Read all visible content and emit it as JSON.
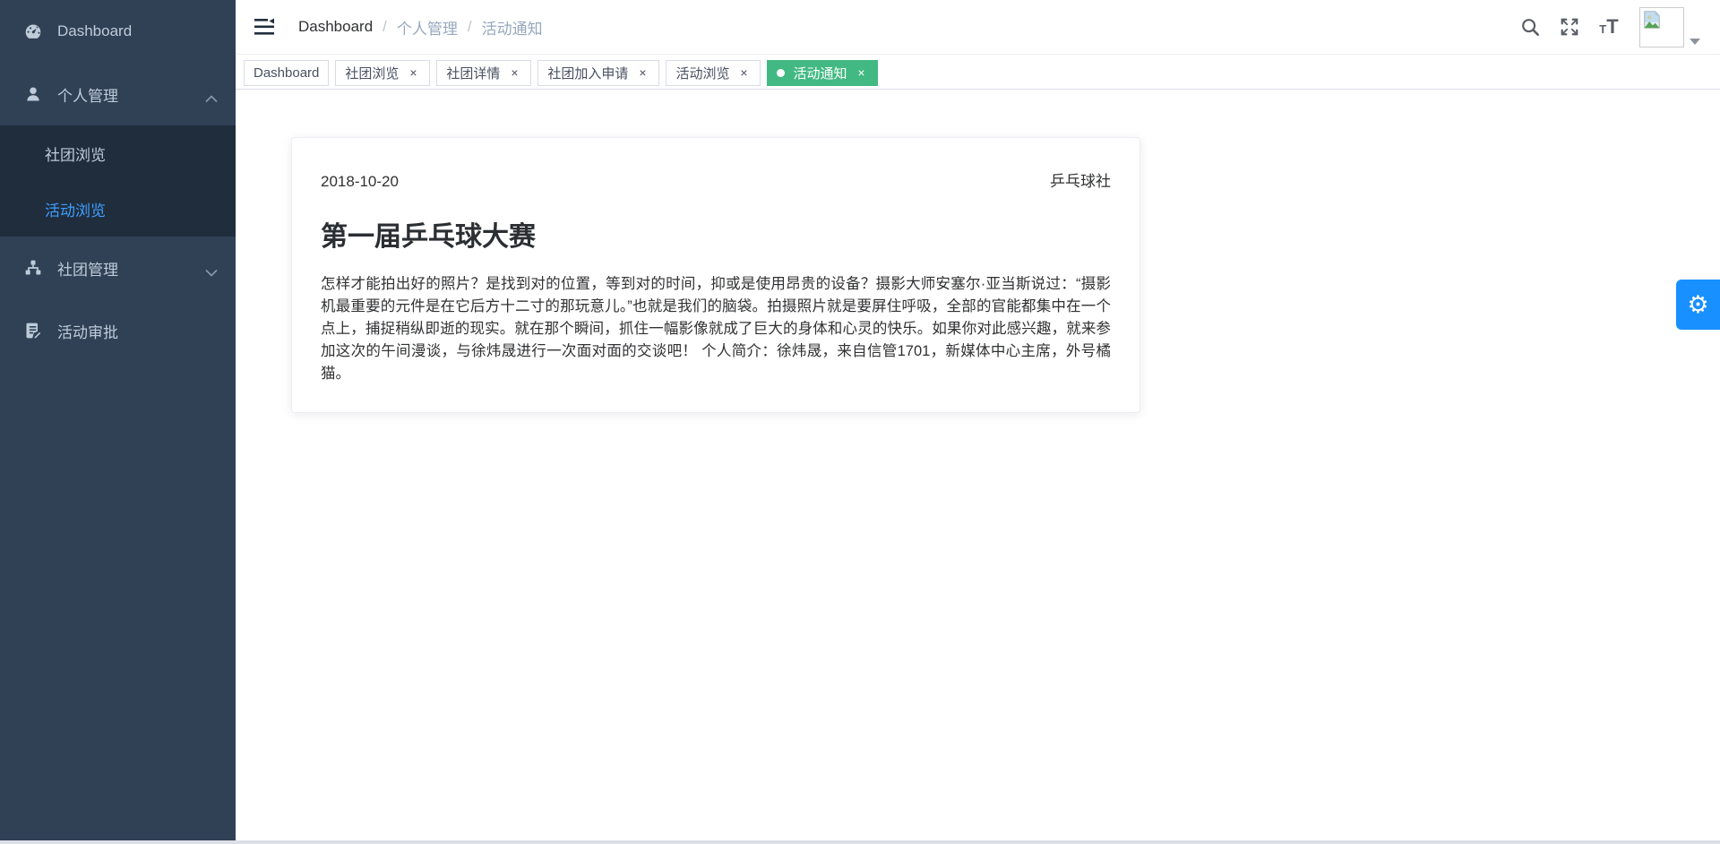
{
  "sidebar": {
    "items": [
      {
        "label": "Dashboard",
        "icon": "dashboard-gauge-icon"
      },
      {
        "label": "个人管理",
        "icon": "person-icon",
        "expanded": true
      },
      {
        "label": "社团浏览"
      },
      {
        "label": "活动浏览",
        "active": true
      },
      {
        "label": "社团管理",
        "icon": "sitemap-icon",
        "expanded": false
      },
      {
        "label": "活动审批",
        "icon": "document-edit-icon"
      }
    ]
  },
  "breadcrumb": {
    "separator": "/",
    "items": [
      "Dashboard",
      "个人管理",
      "活动通知"
    ]
  },
  "header": {
    "icons": [
      "search-icon",
      "fullscreen-icon",
      "text-size-icon",
      "avatar",
      "caret-down-icon"
    ],
    "textsize_small": "T",
    "textsize_large": "T"
  },
  "tagbar": {
    "close_glyph": "×",
    "tags": [
      {
        "label": "Dashboard",
        "closable": false,
        "active": false
      },
      {
        "label": "社团浏览",
        "closable": true,
        "active": false
      },
      {
        "label": "社团详情",
        "closable": true,
        "active": false
      },
      {
        "label": "社团加入申请",
        "closable": true,
        "active": false
      },
      {
        "label": "活动浏览",
        "closable": true,
        "active": false
      },
      {
        "label": "活动通知",
        "closable": true,
        "active": true
      }
    ]
  },
  "notice": {
    "date": "2018-10-20",
    "club": "乒乓球社",
    "title": "第一届乒乓球大赛",
    "body": "怎样才能拍出好的照片？是找到对的位置，等到对的时间，抑或是使用昂贵的设备？摄影大师安塞尔·亚当斯说过：“摄影机最重要的元件是在它后方十二寸的那玩意儿。”也就是我们的脑袋。拍摄照片就是要屏住呼吸，全部的官能都集中在一个点上，捕捉稍纵即逝的现实。就在那个瞬间，抓住一幅影像就成了巨大的身体和心灵的快乐。如果你对此感兴趣，就来参加这次的午间漫谈，与徐炜晟进行一次面对面的交谈吧！ 个人简介：徐炜晟，来自信管1701，新媒体中心主席，外号橘猫。"
  },
  "colors": {
    "sidebar_bg": "#304156",
    "submenu_bg": "#1f2d3d",
    "active_link": "#409eff",
    "active_tag": "#42b983",
    "settings_button": "#1890ff"
  }
}
